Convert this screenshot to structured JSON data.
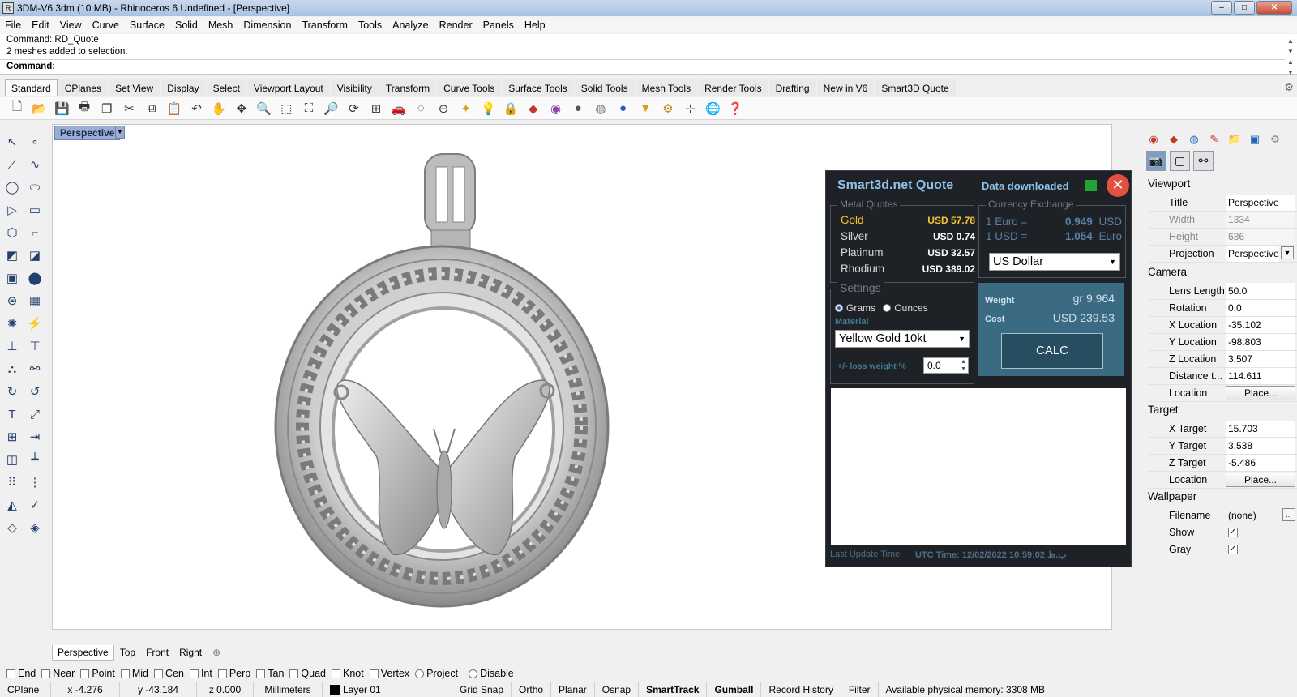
{
  "window": {
    "title": "3DM-V6.3dm (10 MB) - Rhinoceros 6 Undefined - [Perspective]",
    "controls": [
      "–",
      "□",
      "✕"
    ]
  },
  "menu": [
    "File",
    "Edit",
    "View",
    "Curve",
    "Surface",
    "Solid",
    "Mesh",
    "Dimension",
    "Transform",
    "Tools",
    "Analyze",
    "Render",
    "Panels",
    "Help"
  ],
  "command": {
    "history_1": "Command: RD_Quote",
    "history_2": "2 meshes added to selection.",
    "prompt_label": "Command:"
  },
  "toolbar_tabs": [
    "Standard",
    "CPlanes",
    "Set View",
    "Display",
    "Select",
    "Viewport Layout",
    "Visibility",
    "Transform",
    "Curve Tools",
    "Surface Tools",
    "Solid Tools",
    "Mesh Tools",
    "Render Tools",
    "Drafting",
    "New in V6",
    "Smart3D Quote"
  ],
  "toolbar_icons": [
    "new-icon",
    "open-icon",
    "save-icon",
    "print-icon",
    "import-icon",
    "cut-icon",
    "copy-icon",
    "paste-icon",
    "undo-icon",
    "pan-icon",
    "move-icon",
    "zoom-icon",
    "zoom-window-icon",
    "zoom-extents-icon",
    "zoom-selected-icon",
    "rotate-icon",
    "layout-icon",
    "car-icon",
    "hide-icon",
    "show-icon",
    "lock-icon",
    "bulb-icon",
    "padlock-icon",
    "layer-icon",
    "color-icon",
    "shade-icon",
    "render-sphere-icon",
    "material-sphere-icon",
    "filter-icon",
    "gear-options-icon",
    "gumball-icon",
    "globe-icon",
    "help-icon"
  ],
  "viewport": {
    "name": "Perspective",
    "tabs": [
      "Perspective",
      "Top",
      "Front",
      "Right"
    ]
  },
  "quote": {
    "title": "Smart3d.net Quote",
    "status": "Data downloaded",
    "metal_legend": "Metal Quotes",
    "metals": [
      {
        "name": "Gold",
        "price": "USD 57.78"
      },
      {
        "name": "Silver",
        "price": "USD 0.74"
      },
      {
        "name": "Platinum",
        "price": "USD 32.57"
      },
      {
        "name": "Rhodium",
        "price": "USD 389.02"
      }
    ],
    "currency_legend": "Currency Exchange",
    "rates": [
      {
        "label": "1 Euro =",
        "value": "0.949",
        "unit": "USD"
      },
      {
        "label": "1 USD =",
        "value": "1.054",
        "unit": "Euro"
      }
    ],
    "currency_selected": "US Dollar",
    "settings_legend": "Settings",
    "unit_grams": "Grams",
    "unit_ounces": "Ounces",
    "material_label": "Material",
    "material_selected": "Yellow Gold 10kt",
    "loss_label": "+/- loss weight %",
    "loss_value": "0.0",
    "weight_label": "Weight",
    "weight_value": "gr 9.964",
    "cost_label": "Cost",
    "cost_value": "USD  239.53",
    "calc_label": "CALC",
    "footer_label": "Last Update Time",
    "footer_utc": "UTC Time: 12/02/2022 10:59:02 ب.ظ"
  },
  "properties": {
    "viewport_title": "Viewport",
    "title_label": "Title",
    "title_value": "Perspective",
    "width_label": "Width",
    "width_value": "1334",
    "height_label": "Height",
    "height_value": "636",
    "projection_label": "Projection",
    "projection_value": "Perspective",
    "camera_title": "Camera",
    "lens_label": "Lens Length",
    "lens_value": "50.0",
    "rotation_label": "Rotation",
    "rotation_value": "0.0",
    "xloc_label": "X Location",
    "xloc_value": "-35.102",
    "yloc_label": "Y Location",
    "yloc_value": "-98.803",
    "zloc_label": "Z Location",
    "zloc_value": "3.507",
    "dist_label": "Distance t...",
    "dist_value": "114.611",
    "location_label": "Location",
    "place_label": "Place...",
    "target_title": "Target",
    "xt_label": "X Target",
    "xt_value": "15.703",
    "yt_label": "Y Target",
    "yt_value": "3.538",
    "zt_label": "Z Target",
    "zt_value": "-5.486",
    "wallpaper_title": "Wallpaper",
    "filename_label": "Filename",
    "filename_value": "(none)",
    "browse_label": "...",
    "show_label": "Show",
    "gray_label": "Gray"
  },
  "osnaps": [
    "End",
    "Near",
    "Point",
    "Mid",
    "Cen",
    "Int",
    "Perp",
    "Tan",
    "Quad",
    "Knot",
    "Vertex",
    "Project",
    "Disable"
  ],
  "status": {
    "cplane": "CPlane",
    "x": "x -4.276",
    "y": "y -43.184",
    "z": "z 0.000",
    "units": "Millimeters",
    "layer": "Layer 01",
    "grid_snap": "Grid Snap",
    "ortho": "Ortho",
    "planar": "Planar",
    "osnap": "Osnap",
    "smarttrack": "SmartTrack",
    "gumball": "Gumball",
    "record_history": "Record History",
    "filter": "Filter",
    "memory": "Available physical memory: 3308 MB"
  }
}
